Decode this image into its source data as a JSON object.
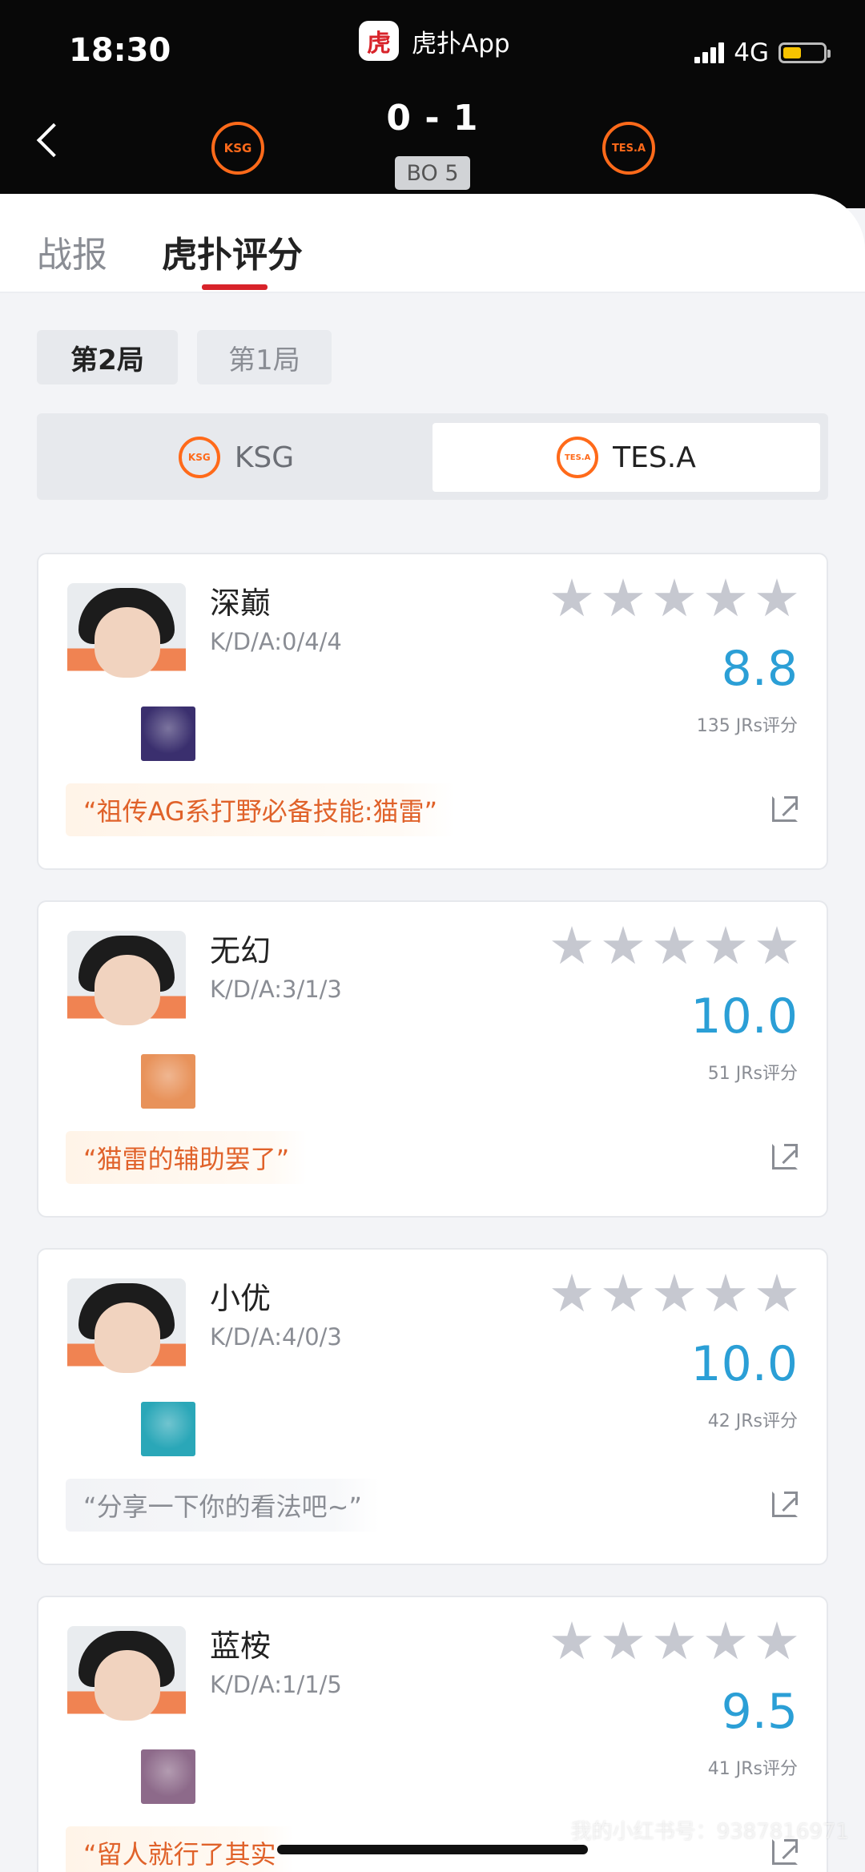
{
  "status_bar": {
    "time": "18:30",
    "network": "4G",
    "battery_percent": 45
  },
  "app": {
    "logo_text": "虎",
    "name": "虎扑App"
  },
  "match": {
    "score": "0 - 1",
    "format": "BO 5",
    "home_logo_text": "KSG",
    "away_logo_text": "TES.A",
    "accent": "#ff6a1a"
  },
  "tabs": [
    {
      "label": "战报"
    },
    {
      "label": "虎扑评分"
    }
  ],
  "games": [
    {
      "label": "第2局"
    },
    {
      "label": "第1局"
    }
  ],
  "teams": [
    {
      "label": "KSG",
      "logo_text": "KSG"
    },
    {
      "label": "TES.A",
      "logo_text": "TES.A"
    }
  ],
  "players": [
    {
      "name": "深巅",
      "kda": "K/D/A:0/4/4",
      "rating": "8.8",
      "votes": "135 JRs评分",
      "comment": "“祖传AG系打野必备技能:猫雷”",
      "hero_color": "#3a2f6e",
      "stars": 5
    },
    {
      "name": "无幻",
      "kda": "K/D/A:3/1/3",
      "rating": "10.0",
      "votes": "51 JRs评分",
      "comment": "“猫雷的辅助罢了”",
      "hero_color": "#e8925a",
      "stars": 5
    },
    {
      "name": "小优",
      "kda": "K/D/A:4/0/3",
      "rating": "10.0",
      "votes": "42 JRs评分",
      "comment": "“分享一下你的看法吧~”",
      "hero_color": "#2aa7b8",
      "stars": 5
    },
    {
      "name": "蓝桉",
      "kda": "K/D/A:1/1/5",
      "rating": "9.5",
      "votes": "41 JRs评分",
      "comment": "“留人就行了其实",
      "hero_color": "#8d6a8a",
      "stars": 5
    }
  ],
  "watermark": "我的小红书号：9387816971",
  "colors": {
    "rating": "#2b9fd6",
    "tab_underline": "#d8232a",
    "comment": "#e0622a"
  }
}
